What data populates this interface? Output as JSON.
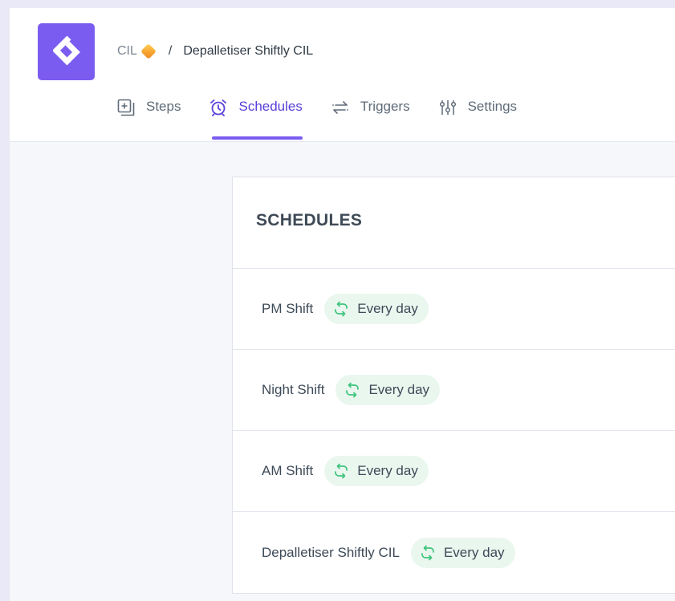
{
  "breadcrumb": {
    "root": "CIL",
    "separator": "/",
    "current": "Depalletiser Shiftly CIL"
  },
  "tabs": [
    {
      "label": "Steps",
      "icon": "add-step-icon",
      "active": false
    },
    {
      "label": "Schedules",
      "icon": "alarm-clock-icon",
      "active": true
    },
    {
      "label": "Triggers",
      "icon": "arrows-swap-icon",
      "active": false
    },
    {
      "label": "Settings",
      "icon": "sliders-icon",
      "active": false
    }
  ],
  "schedules": {
    "title": "SCHEDULES",
    "items": [
      {
        "name": "PM Shift",
        "recurrence": "Every day"
      },
      {
        "name": "Night Shift",
        "recurrence": "Every day"
      },
      {
        "name": "AM Shift",
        "recurrence": "Every day"
      },
      {
        "name": "Depalletiser Shiftly CIL",
        "recurrence": "Every day"
      }
    ]
  },
  "colors": {
    "brand": "#7b5cf0",
    "active_tab": "#5b40d8",
    "badge_bg": "#eaf7ef",
    "repeat_icon": "#3cc47c"
  }
}
